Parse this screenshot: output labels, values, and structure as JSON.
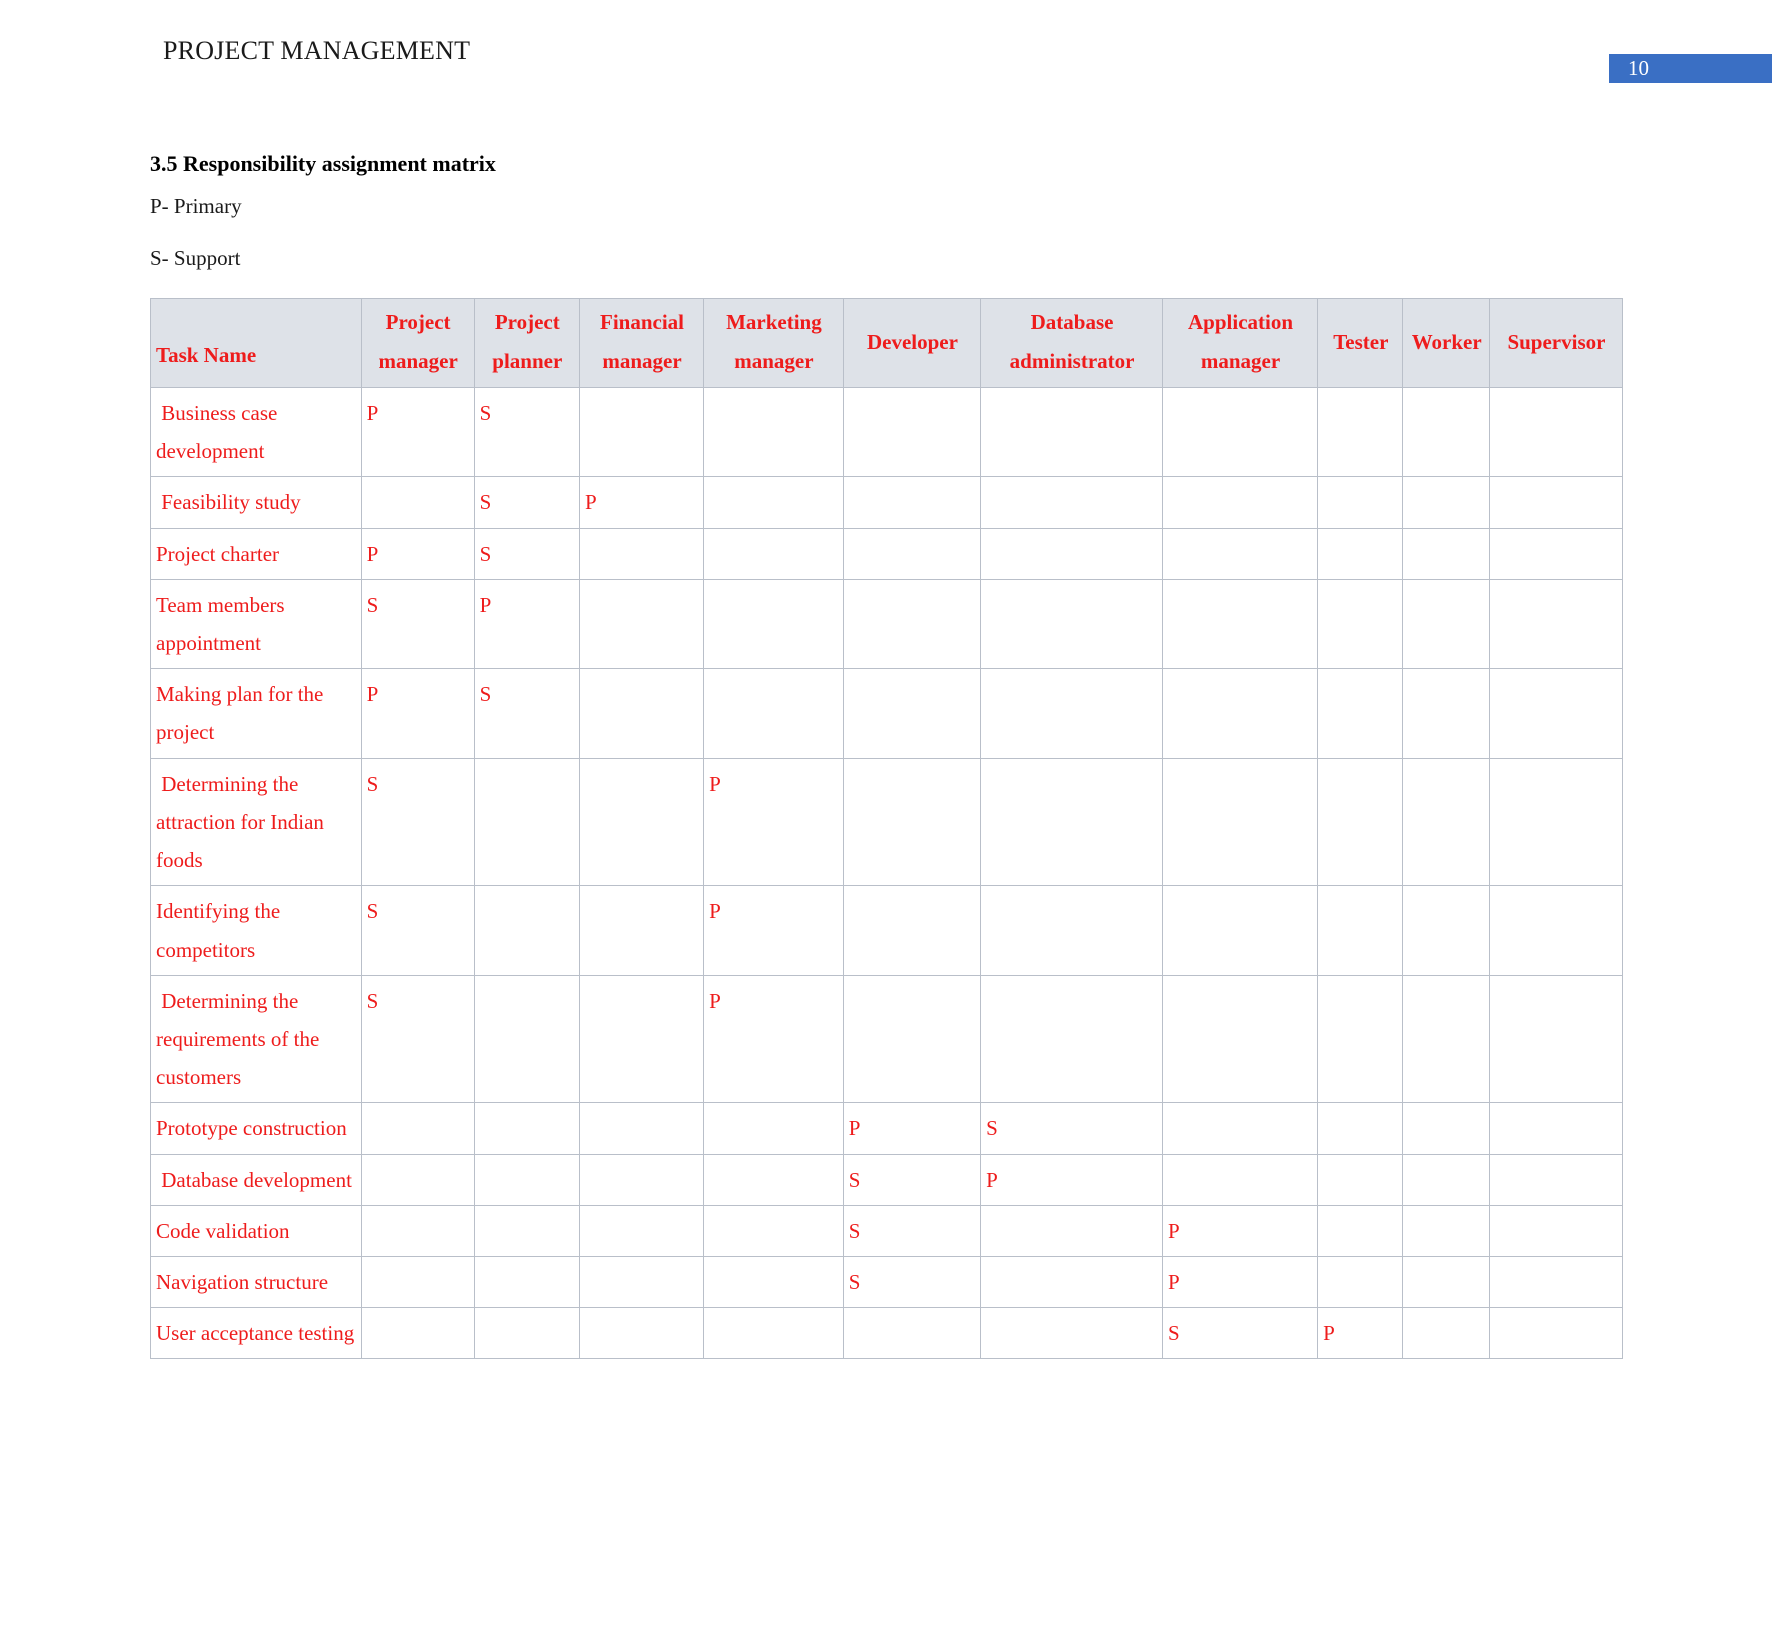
{
  "header": {
    "document_title": "PROJECT MANAGEMENT",
    "page_number": "10",
    "page_number_color": "#3a6fc4"
  },
  "section": {
    "heading": "3.5 Responsibility assignment matrix",
    "legend_primary": "P- Primary",
    "legend_support": "S- Support"
  },
  "table": {
    "header_background": "#dee2e8",
    "text_color": "#ee1c1c",
    "columns": [
      "Task Name",
      "Project manager",
      "Project planner",
      "Financial manager",
      "Marketing manager",
      "Developer",
      "Database administrator",
      "Application manager",
      "Tester",
      "Worker",
      "Supervisor"
    ],
    "rows": [
      {
        "task": " Business case development",
        "marks": [
          "P",
          "S",
          "",
          "",
          "",
          "",
          "",
          "",
          "",
          ""
        ]
      },
      {
        "task": " Feasibility study",
        "marks": [
          "",
          "S",
          "P",
          "",
          "",
          "",
          "",
          "",
          "",
          ""
        ]
      },
      {
        "task": "Project charter",
        "marks": [
          "P",
          "S",
          "",
          "",
          "",
          "",
          "",
          "",
          "",
          ""
        ]
      },
      {
        "task": "Team members appointment",
        "marks": [
          "S",
          "P",
          "",
          "",
          "",
          "",
          "",
          "",
          "",
          ""
        ]
      },
      {
        "task": "Making plan for the project",
        "marks": [
          "P",
          "S",
          "",
          "",
          "",
          "",
          "",
          "",
          "",
          ""
        ]
      },
      {
        "task": " Determining the attraction for Indian foods",
        "marks": [
          "S",
          "",
          "",
          "P",
          "",
          "",
          "",
          "",
          "",
          ""
        ]
      },
      {
        "task": "Identifying the competitors",
        "marks": [
          "S",
          "",
          "",
          "P",
          "",
          "",
          "",
          "",
          "",
          ""
        ]
      },
      {
        "task": " Determining the requirements of the customers",
        "marks": [
          "S",
          "",
          "",
          "P",
          "",
          "",
          "",
          "",
          "",
          ""
        ]
      },
      {
        "task": "Prototype construction",
        "marks": [
          "",
          "",
          "",
          "",
          "P",
          "S",
          "",
          "",
          "",
          ""
        ]
      },
      {
        "task": " Database development",
        "marks": [
          "",
          "",
          "",
          "",
          "S",
          "P",
          "",
          "",
          "",
          ""
        ]
      },
      {
        "task": "Code validation",
        "marks": [
          "",
          "",
          "",
          "",
          "S",
          "",
          "P",
          "",
          "",
          ""
        ]
      },
      {
        "task": "Navigation structure",
        "marks": [
          "",
          "",
          "",
          "",
          "S",
          "",
          "P",
          "",
          "",
          ""
        ]
      },
      {
        "task": "User acceptance testing",
        "marks": [
          "",
          "",
          "",
          "",
          "",
          "",
          "S",
          "P",
          "",
          ""
        ]
      }
    ]
  }
}
